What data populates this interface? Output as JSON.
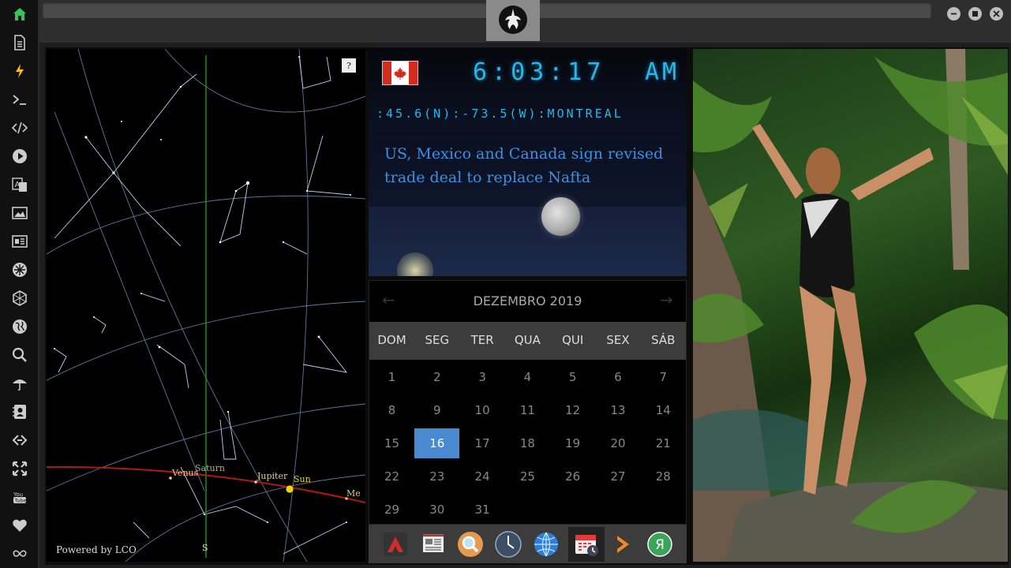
{
  "sidebar": {
    "items": [
      {
        "icon": "home-icon",
        "color": "#35c25a"
      },
      {
        "icon": "document-icon"
      },
      {
        "icon": "lightning-icon",
        "color": "#f5c400"
      },
      {
        "icon": "terminal-icon"
      },
      {
        "icon": "code-icon"
      },
      {
        "icon": "play-icon"
      },
      {
        "icon": "translate-icon"
      },
      {
        "icon": "image-icon"
      },
      {
        "icon": "news-icon"
      },
      {
        "icon": "rebel-emblem-icon"
      },
      {
        "icon": "hexagon-icon"
      },
      {
        "icon": "globe-icon"
      },
      {
        "icon": "search-icon"
      },
      {
        "icon": "umbrella-icon"
      },
      {
        "icon": "contacts-icon"
      },
      {
        "icon": "link-icon"
      },
      {
        "icon": "expand-icon"
      },
      {
        "icon": "youtube-icon"
      },
      {
        "icon": "heart-icon"
      },
      {
        "icon": "infinity-icon"
      }
    ]
  },
  "skymap": {
    "help": "?",
    "credit": "Powered by LCO",
    "labels": {
      "venus": "Venus",
      "saturn": "Saturn",
      "jupiter": "Jupiter",
      "sun": "Sun",
      "mercury": "Me",
      "south": "S"
    }
  },
  "clock": {
    "time": "6:03:17",
    "ampm": "AM",
    "location": ":45.6(N):-73.5(W):MONTREAL",
    "headline": "US, Mexico and Canada sign revised trade deal to replace Nafta",
    "accent": "#24b7ea"
  },
  "calendar": {
    "title": "DEZEMBRO 2019",
    "weekdays": [
      "DOM",
      "SEG",
      "TER",
      "QUA",
      "QUI",
      "SEX",
      "SÁB"
    ],
    "weeks": [
      [
        "1",
        "2",
        "3",
        "4",
        "5",
        "6",
        "7"
      ],
      [
        "8",
        "9",
        "10",
        "11",
        "12",
        "13",
        "14"
      ],
      [
        "15",
        "16",
        "17",
        "18",
        "19",
        "20",
        "21"
      ],
      [
        "22",
        "23",
        "24",
        "25",
        "26",
        "27",
        "28"
      ],
      [
        "29",
        "30",
        "31"
      ]
    ],
    "selected": "16",
    "selected_color": "#4a8ad0"
  },
  "taskbar": {
    "items": [
      {
        "icon": "app-launcher-icon"
      },
      {
        "icon": "newspaper-icon"
      },
      {
        "icon": "search-icon"
      },
      {
        "icon": "clock-icon"
      },
      {
        "icon": "globe-icon"
      },
      {
        "icon": "calendar-icon",
        "active": true
      },
      {
        "icon": "arrow-right-icon"
      },
      {
        "icon": "yandex-icon",
        "letter": "Я"
      }
    ]
  }
}
